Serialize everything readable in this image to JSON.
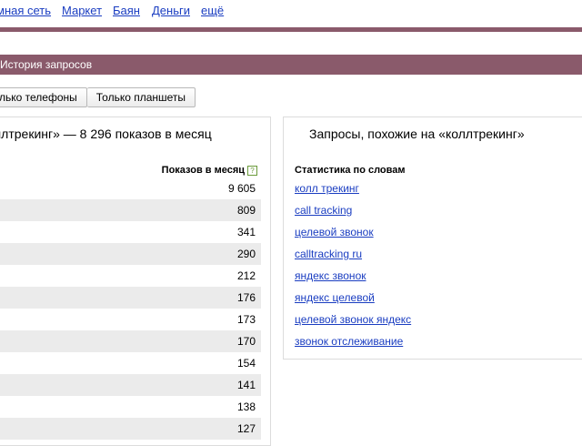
{
  "nav": {
    "items": [
      "мная сеть",
      "Маркет",
      "Баян",
      "Деньги",
      "ещё"
    ]
  },
  "header": {
    "section_title": "История запросов"
  },
  "filters": {
    "phones_label": "лько телефоны",
    "tablets_label": "Только планшеты"
  },
  "left_panel": {
    "title": "ллтрекинг» — 8 296 показов в месяц",
    "column_header": "Показов в месяц",
    "help_glyph": "?",
    "values": [
      "9 605",
      "809",
      "341",
      "290",
      "212",
      "176",
      "173",
      "170",
      "154",
      "141",
      "138",
      "127"
    ]
  },
  "right_panel": {
    "title": "Запросы, похожие на «коллтрекинг»",
    "column_header": "Статистика по словам",
    "links": [
      "колл трекинг",
      "call tracking",
      "целевой звонок",
      "calltracking ru",
      "яндекс звонок",
      "яндекс целевой",
      "целевой звонок яндекс",
      "звонок отслеживание"
    ]
  },
  "colors": {
    "accent_band": "#8a5a6b",
    "link": "#1a3dc1",
    "row_shade": "#ebebeb"
  }
}
